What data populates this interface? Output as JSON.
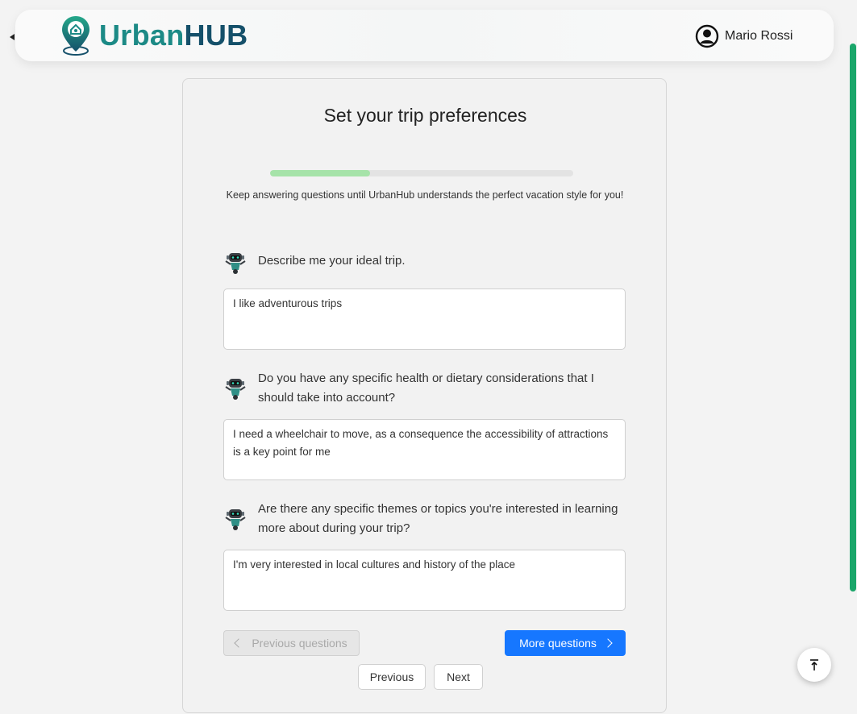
{
  "header": {
    "logo_part1": "Urban",
    "logo_part2": "HUB",
    "user_name": "Mario Rossi",
    "icons": {
      "back": "back-arrow-icon",
      "logo": "map-pin-home-icon",
      "user": "user-circle-icon"
    },
    "colors": {
      "urban": "#1c8a86",
      "hub": "#15506a"
    }
  },
  "card": {
    "title": "Set your trip preferences",
    "progress_percent": 33,
    "subtitle": "Keep answering questions until UrbanHub understands the perfect vacation style for you!",
    "questions": [
      {
        "question": "Describe me your ideal trip.",
        "answer": "I like adventurous trips",
        "icon": "robot-icon"
      },
      {
        "question": "Do you have any specific health or dietary considerations that I should take into account?",
        "answer": "I need a wheelchair to move, as a consequence the accessibility of attractions is a key point for me",
        "icon": "robot-icon"
      },
      {
        "question": "Are there any specific themes or topics you're interested in learning more about during your trip?",
        "answer": "I'm very interested in local cultures and history of the place",
        "icon": "robot-icon"
      }
    ],
    "buttons": {
      "previous_questions": "Previous questions",
      "more_questions": "More questions",
      "previous": "Previous",
      "next": "Next"
    },
    "colors": {
      "progress": "#a6e3a9",
      "primary": "#1677ff"
    }
  },
  "scroll_top_icon": "arrow-up-to-line-icon",
  "scrollbar_color": "#1aa66a"
}
